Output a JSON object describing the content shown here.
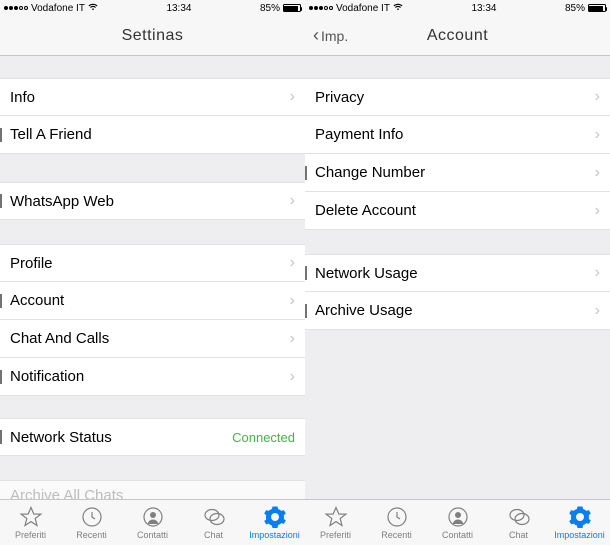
{
  "left": {
    "status": {
      "carrier": "Vodafone IT",
      "time": "13:34",
      "battery_pct": "85%"
    },
    "nav": {
      "title": "Settinas"
    },
    "rows": {
      "info": "Info",
      "tell": "Tell A Friend",
      "waweb": "WhatsApp Web",
      "profile": "Profile",
      "account": "Account",
      "chat_calls": "Chat And Calls",
      "notification": "Notification",
      "network_status_label": "Network Status",
      "network_status_value": "Connected",
      "archive_all": "Archive All Chats"
    }
  },
  "right": {
    "status": {
      "carrier": "Vodafone IT",
      "time": "13:34",
      "battery_pct": "85%"
    },
    "nav": {
      "back": "Imp.",
      "title": "Account"
    },
    "rows": {
      "privacy": "Privacy",
      "payment": "Payment Info",
      "change_num": "Change Number",
      "delete_acct": "Delete Account",
      "net_usage": "Network Usage",
      "archive_usage": "Archive Usage"
    }
  },
  "tabs": {
    "preferiti": "Preferiti",
    "recenti": "Recenti",
    "contatti": "Contatti",
    "chat": "Chat",
    "impostazioni": "Impostazioni"
  }
}
